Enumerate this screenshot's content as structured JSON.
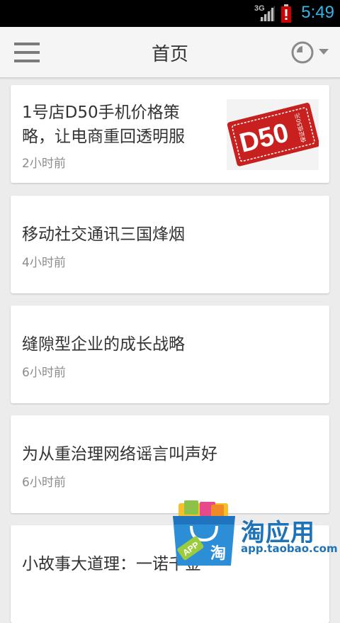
{
  "status_bar": {
    "network": "3G",
    "time": "5:49",
    "icons": [
      "signal-icon",
      "battery-alert-icon"
    ]
  },
  "action_bar": {
    "title": "首页",
    "menu_icon": "hamburger-menu-icon",
    "history_icon": "clock-dropdown-icon"
  },
  "articles": [
    {
      "title": "1号店D50手机价格策略，让电商重回透明服",
      "title_lines": [
        "1号店D50手机价格策",
        "略，让电商重回透明服"
      ],
      "time": "2小时前",
      "thumbnail_text": "D50",
      "thumbnail_sub": "保证低50元"
    },
    {
      "title": "移动社交通讯三国烽烟",
      "time": "4小时前"
    },
    {
      "title": "缝隙型企业的成长战略",
      "time": "6小时前"
    },
    {
      "title": "为从重治理网络谣言叫声好",
      "time": "6小时前"
    },
    {
      "title": "小故事大道理：一诺千金",
      "time": ""
    }
  ],
  "watermark": {
    "title": "淘应用",
    "url": "app.taobao.com",
    "badge_text": "APP",
    "bag_text": "淘"
  },
  "colors": {
    "clock": "#33b5e5",
    "thumbnail_red": "#c8201e",
    "watermark_blue": "#1e73b8"
  }
}
